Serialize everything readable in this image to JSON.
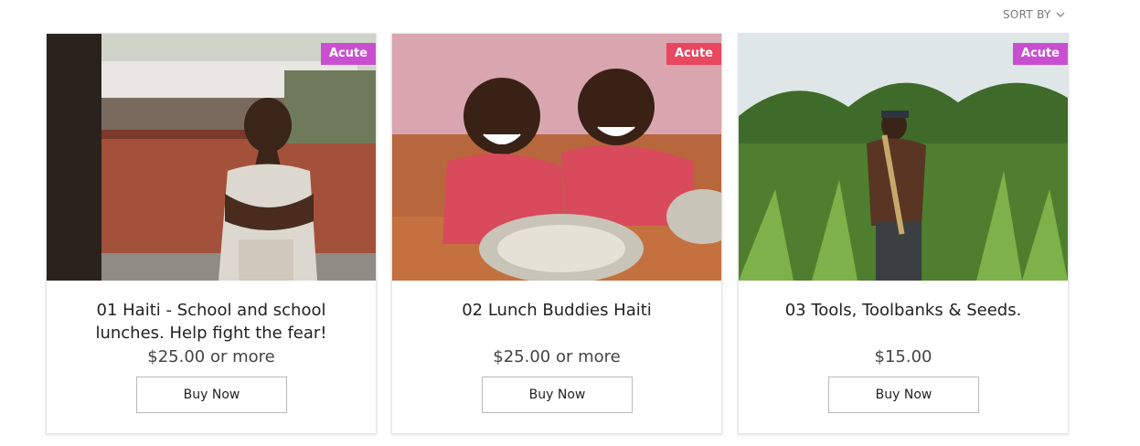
{
  "sort": {
    "label": "SORT BY"
  },
  "products": [
    {
      "badge": "Acute",
      "badge_color": "#c94fd0",
      "title": "01 Haiti - School and school lunches. Help fight the fear!",
      "price_amount": "$25.00",
      "price_suffix": " or more",
      "buy_label": "Buy Now"
    },
    {
      "badge": "Acute",
      "badge_color": "#e9465f",
      "title": "02 Lunch Buddies Haiti",
      "price_amount": "$25.00",
      "price_suffix": " or more",
      "buy_label": "Buy Now"
    },
    {
      "badge": "Acute",
      "badge_color": "#c94fd0",
      "title": "03 Tools, Toolbanks & Seeds.",
      "price_amount": "$15.00",
      "price_suffix": "",
      "buy_label": "Buy Now"
    }
  ]
}
